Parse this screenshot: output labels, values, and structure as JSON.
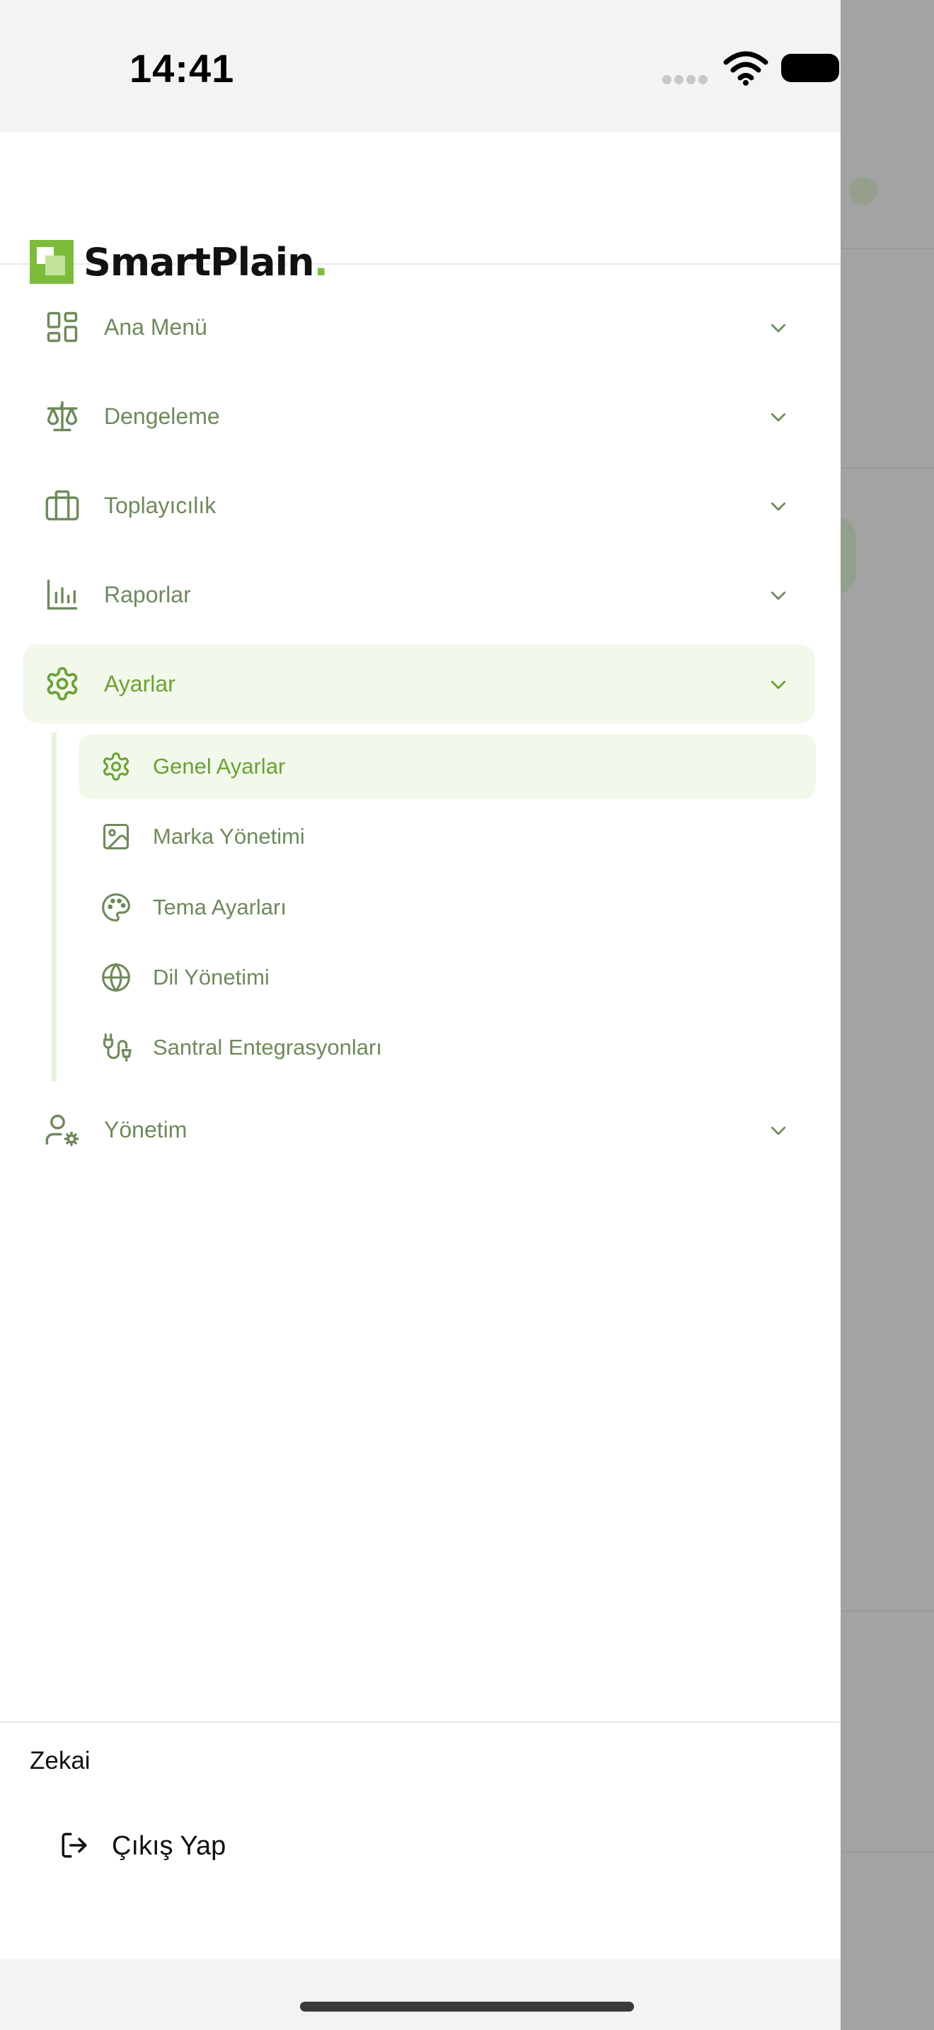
{
  "status_bar": {
    "time": "14:41"
  },
  "brand": {
    "name": "SmartPlain",
    "dot": ".",
    "accent_color": "#7bbd3a"
  },
  "menu": {
    "items": [
      {
        "label": "Ana Menü",
        "icon": "dashboard-grid-icon",
        "active": false
      },
      {
        "label": "Dengeleme",
        "icon": "scale-icon",
        "active": false
      },
      {
        "label": "Toplayıcılık",
        "icon": "briefcase-icon",
        "active": false
      },
      {
        "label": "Raporlar",
        "icon": "bar-chart-icon",
        "active": false
      },
      {
        "label": "Ayarlar",
        "icon": "gear-icon",
        "active": true,
        "expanded": true
      },
      {
        "label": "Yönetim",
        "icon": "user-gear-icon",
        "active": false
      }
    ],
    "sub_items": [
      {
        "label": "Genel Ayarlar",
        "icon": "gear-icon",
        "active": true
      },
      {
        "label": "Marka Yönetimi",
        "icon": "image-icon",
        "active": false
      },
      {
        "label": "Tema Ayarları",
        "icon": "palette-icon",
        "active": false
      },
      {
        "label": "Dil Yönetimi",
        "icon": "globe-icon",
        "active": false
      },
      {
        "label": "Santral Entegrasyonları",
        "icon": "plug-icon",
        "active": false
      }
    ]
  },
  "user": {
    "name": "Zekai"
  },
  "logout": {
    "label": "Çıkış Yap",
    "icon": "logout-icon"
  },
  "colors": {
    "text_muted": "#6e8a5a",
    "text_active": "#6aa232",
    "active_bg": "#f2f9eb"
  }
}
